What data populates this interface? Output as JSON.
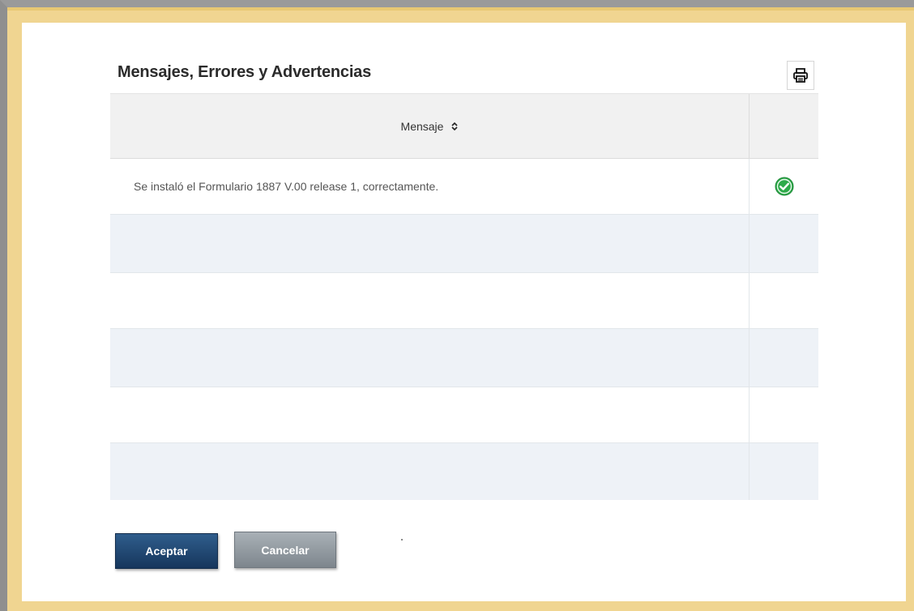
{
  "dialog": {
    "title": "Mensajes, Errores y Advertencias",
    "print_icon": "printer-icon"
  },
  "table": {
    "columns": [
      {
        "label": "Mensaje",
        "sort_icon": "sort-updown-icon"
      },
      {
        "label": ""
      }
    ],
    "rows": [
      {
        "message": "Se instaló el Formulario 1887 V.00 release 1, correctamente.",
        "status_icon": "success-check-icon",
        "status_color": "#2eaa4a"
      },
      {
        "message": "",
        "status_icon": ""
      },
      {
        "message": "",
        "status_icon": ""
      },
      {
        "message": "",
        "status_icon": ""
      },
      {
        "message": "",
        "status_icon": ""
      },
      {
        "message": "",
        "status_icon": ""
      }
    ]
  },
  "buttons": {
    "accept_label": "Aceptar",
    "cancel_label": "Cancelar"
  },
  "colors": {
    "frame": "#f0d591",
    "accept": "#1f4673",
    "cancel": "#8b9399",
    "row_alt": "#eef2f7"
  }
}
